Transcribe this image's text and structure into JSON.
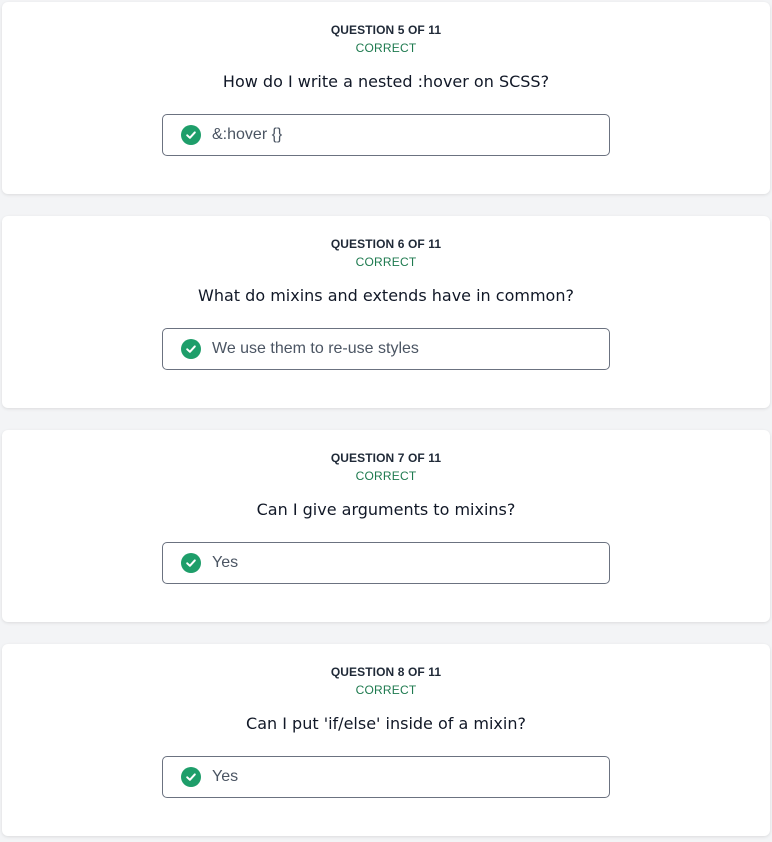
{
  "accent_color": "#1e9e6a",
  "status_color": "#1e7a4f",
  "questions": [
    {
      "number_label": "QUESTION 5 OF 11",
      "status": "CORRECT",
      "question": "How do I write a nested :hover on SCSS?",
      "answer": "&:hover {}",
      "icon": "check-circle-icon"
    },
    {
      "number_label": "QUESTION 6 OF 11",
      "status": "CORRECT",
      "question": "What do mixins and extends have in common?",
      "answer": "We use them to re-use styles",
      "icon": "check-circle-icon"
    },
    {
      "number_label": "QUESTION 7 OF 11",
      "status": "CORRECT",
      "question": "Can I give arguments to mixins?",
      "answer": "Yes",
      "icon": "check-circle-icon"
    },
    {
      "number_label": "QUESTION 8 OF 11",
      "status": "CORRECT",
      "question": "Can I put 'if/else' inside of a mixin?",
      "answer": "Yes",
      "icon": "check-circle-icon"
    }
  ]
}
